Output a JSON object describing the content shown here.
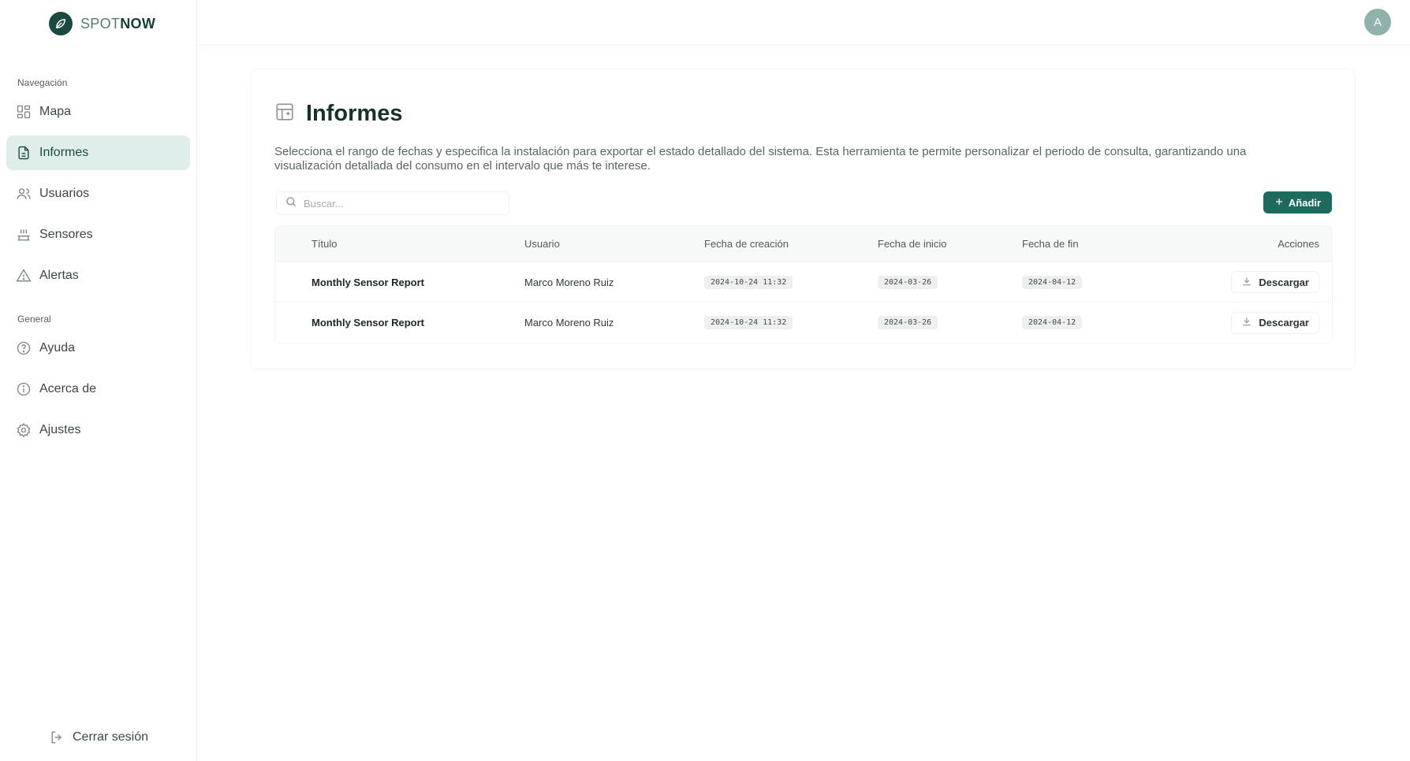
{
  "brand": {
    "name_light": "SPOT",
    "name_bold": "NOW"
  },
  "sidebar": {
    "nav_section": "Navegación",
    "general_section": "General",
    "nav_items": [
      {
        "label": "Mapa",
        "icon": "grid-icon"
      },
      {
        "label": "Informes",
        "icon": "document-icon",
        "active": true
      },
      {
        "label": "Usuarios",
        "icon": "users-icon"
      },
      {
        "label": "Sensores",
        "icon": "sensor-icon"
      },
      {
        "label": "Alertas",
        "icon": "warning-icon"
      }
    ],
    "general_items": [
      {
        "label": "Ayuda",
        "icon": "help-icon"
      },
      {
        "label": "Acerca de",
        "icon": "info-icon"
      },
      {
        "label": "Ajustes",
        "icon": "gear-icon"
      }
    ],
    "logout": "Cerrar sesión"
  },
  "topbar": {
    "avatar_initial": "A"
  },
  "page": {
    "title": "Informes",
    "description": "Selecciona el rango de fechas y especifica la instalación para exportar el estado detallado del sistema. Esta herramienta te permite personalizar el periodo de consulta, garantizando una visualización detallada del consumo en el intervalo que más te interese.",
    "search_placeholder": "Buscar...",
    "add_label": "Añadir"
  },
  "table": {
    "columns": [
      "Título",
      "Usuario",
      "Fecha de creación",
      "Fecha de inicio",
      "Fecha de fin",
      "Acciones"
    ],
    "rows": [
      {
        "title": "Monthly Sensor Report",
        "user": "Marco Moreno Ruiz",
        "created": "2024-10-24 11:32",
        "start": "2024-03-26",
        "end": "2024-04-12",
        "action": "Descargar"
      },
      {
        "title": "Monthly Sensor Report",
        "user": "Marco Moreno Ruiz",
        "created": "2024-10-24 11:32",
        "start": "2024-03-26",
        "end": "2024-04-12",
        "action": "Descargar"
      }
    ]
  },
  "colors": {
    "brand": "#1b4a43",
    "accent": "#1e6b5e",
    "active_nav_bg": "#dfeeea",
    "avatar_bg": "#8fb3ab"
  }
}
